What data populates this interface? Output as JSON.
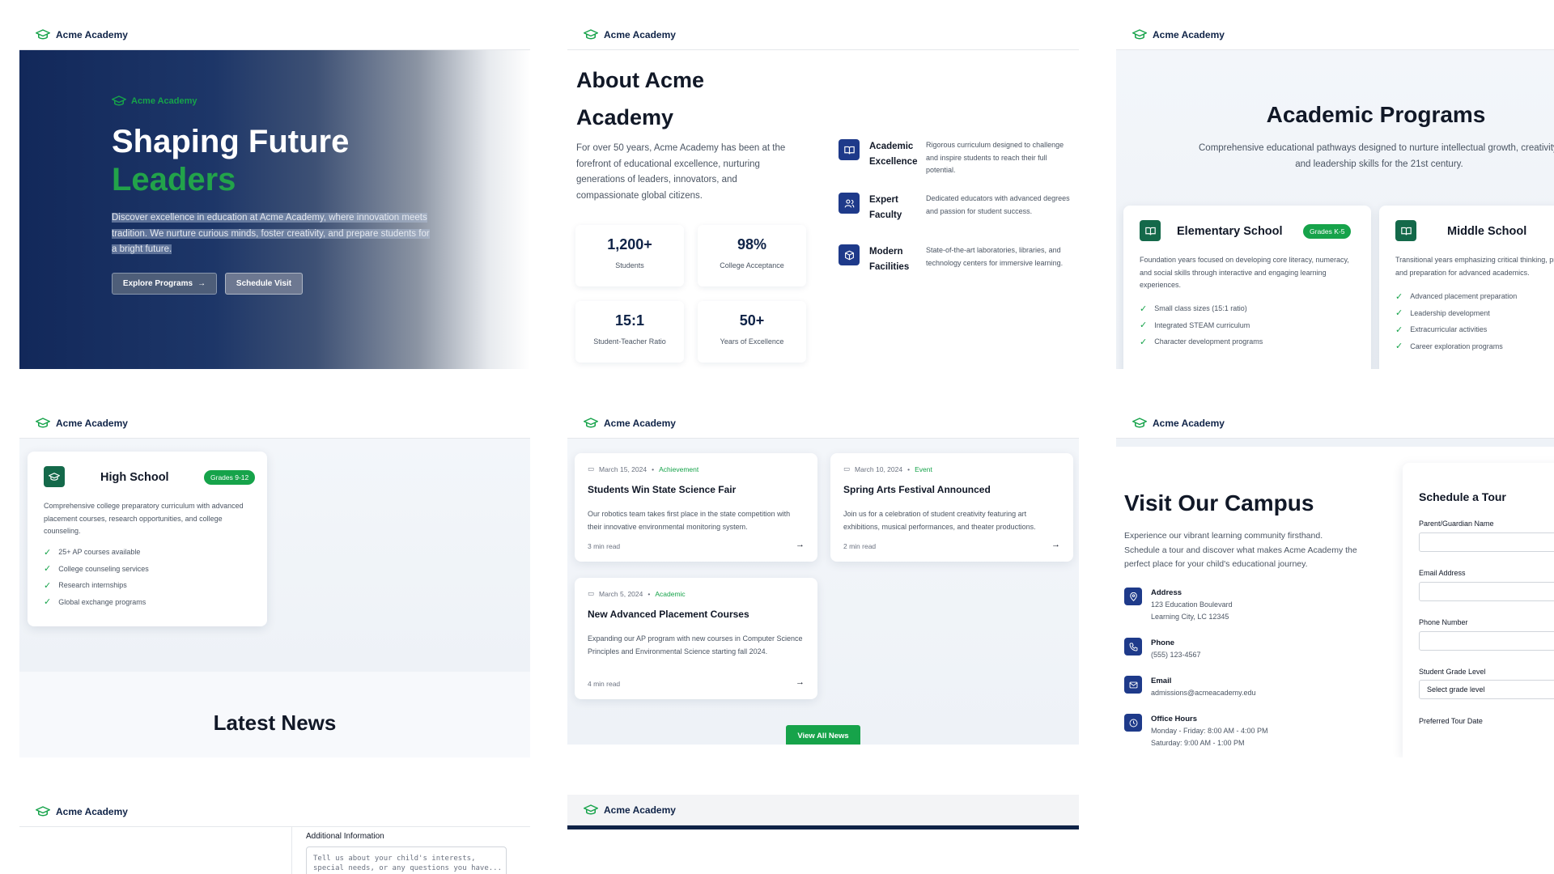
{
  "brand": {
    "name": "Acme Academy"
  },
  "hero": {
    "tag": "Acme Academy",
    "title_line1": "Shaping Future",
    "title_line2": "Leaders",
    "description": "Discover excellence in education at Acme Academy, where innovation meets tradition. We nurture curious minds, foster creativity, and prepare students for a bright future.",
    "btn_explore": "Explore Programs",
    "btn_schedule": "Schedule Visit"
  },
  "about": {
    "title": "About Acme Academy",
    "text": "For over 50 years, Acme Academy has been at the forefront of educational excellence, nurturing generations of leaders, innovators, and compassionate global citizens.",
    "stats": [
      {
        "value": "1,200+",
        "label": "Students"
      },
      {
        "value": "98%",
        "label": "College Acceptance"
      },
      {
        "value": "15:1",
        "label": "Student-Teacher Ratio"
      },
      {
        "value": "50+",
        "label": "Years of Excellence"
      }
    ],
    "features": [
      {
        "title": "Academic Excellence",
        "desc": "Rigorous curriculum designed to challenge and inspire students to reach their full potential.",
        "icon": "book-icon"
      },
      {
        "title": "Expert Faculty",
        "desc": "Dedicated educators with advanced degrees and passion for student success.",
        "icon": "users-icon"
      },
      {
        "title": "Modern Facilities",
        "desc": "State-of-the-art laboratories, libraries, and technology centers for immersive learning.",
        "icon": "cube-icon"
      }
    ]
  },
  "programs": {
    "title": "Academic Programs",
    "subtitle": "Comprehensive educational pathways designed to nurture intellectual growth, creativity, and leadership skills for the 21st century.",
    "elementary": {
      "name": "Elementary School",
      "badge": "Grades K-5",
      "desc": "Foundation years focused on developing core literacy, numeracy, and social skills through interactive and engaging learning experiences.",
      "items": [
        "Small class sizes (15:1 ratio)",
        "Integrated STEAM curriculum",
        "Character development programs"
      ]
    },
    "middle": {
      "name": "Middle School",
      "desc": "Transitional years emphasizing critical thinking, problem-solving, and preparation for advanced academics.",
      "items": [
        "Advanced placement preparation",
        "Leadership development",
        "Extracurricular activities",
        "Career exploration programs"
      ]
    },
    "high": {
      "name": "High School",
      "badge": "Grades 9-12",
      "desc": "Comprehensive college preparatory curriculum with advanced placement courses, research opportunities, and college counseling.",
      "items": [
        "25+ AP courses available",
        "College counseling services",
        "Research internships",
        "Global exchange programs"
      ]
    }
  },
  "news": {
    "title": "Latest News",
    "articles": [
      {
        "date": "March 15, 2024",
        "category": "Achievement",
        "title": "Students Win State Science Fair",
        "desc": "Our robotics team takes first place in the state competition with their innovative environmental monitoring system.",
        "read": "3 min read"
      },
      {
        "date": "March 10, 2024",
        "category": "Event",
        "title": "Spring Arts Festival Announced",
        "desc": "Join us for a celebration of student creativity featuring art exhibitions, musical performances, and theater productions.",
        "read": "2 min read"
      },
      {
        "date": "March 5, 2024",
        "category": "Academic",
        "title": "New Advanced Placement Courses",
        "desc": "Expanding our AP program with new courses in Computer Science Principles and Environmental Science starting fall 2024.",
        "read": "4 min read"
      }
    ],
    "view_all": "View All News"
  },
  "visit": {
    "title": "Visit Our Campus",
    "text": "Experience our vibrant learning community firsthand. Schedule a tour and discover what makes Acme Academy the perfect place for your child's educational journey.",
    "address_label": "Address",
    "address_line1": "123 Education Boulevard",
    "address_line2": "Learning City, LC 12345",
    "phone_label": "Phone",
    "phone": "(555) 123-4567",
    "email_label": "Email",
    "email": "admissions@acmeacademy.edu",
    "hours_label": "Office Hours",
    "hours_line1": "Monday - Friday: 8:00 AM - 4:00 PM",
    "hours_line2": "Saturday: 9:00 AM - 1:00 PM"
  },
  "form": {
    "title": "Schedule a Tour",
    "name_label": "Parent/Guardian Name",
    "email_label": "Email Address",
    "phone_label": "Phone Number",
    "grade_label": "Student Grade Level",
    "grade_value": "Select grade level",
    "date_label": "Preferred Tour Date",
    "additional_label": "Additional Information",
    "additional_placeholder": "Tell us about your child's interests,\nspecial needs, or any questions you have..."
  },
  "colors": {
    "navy": "#0f2347",
    "green": "#16a34a",
    "icon_blue": "#1e3a8a"
  }
}
